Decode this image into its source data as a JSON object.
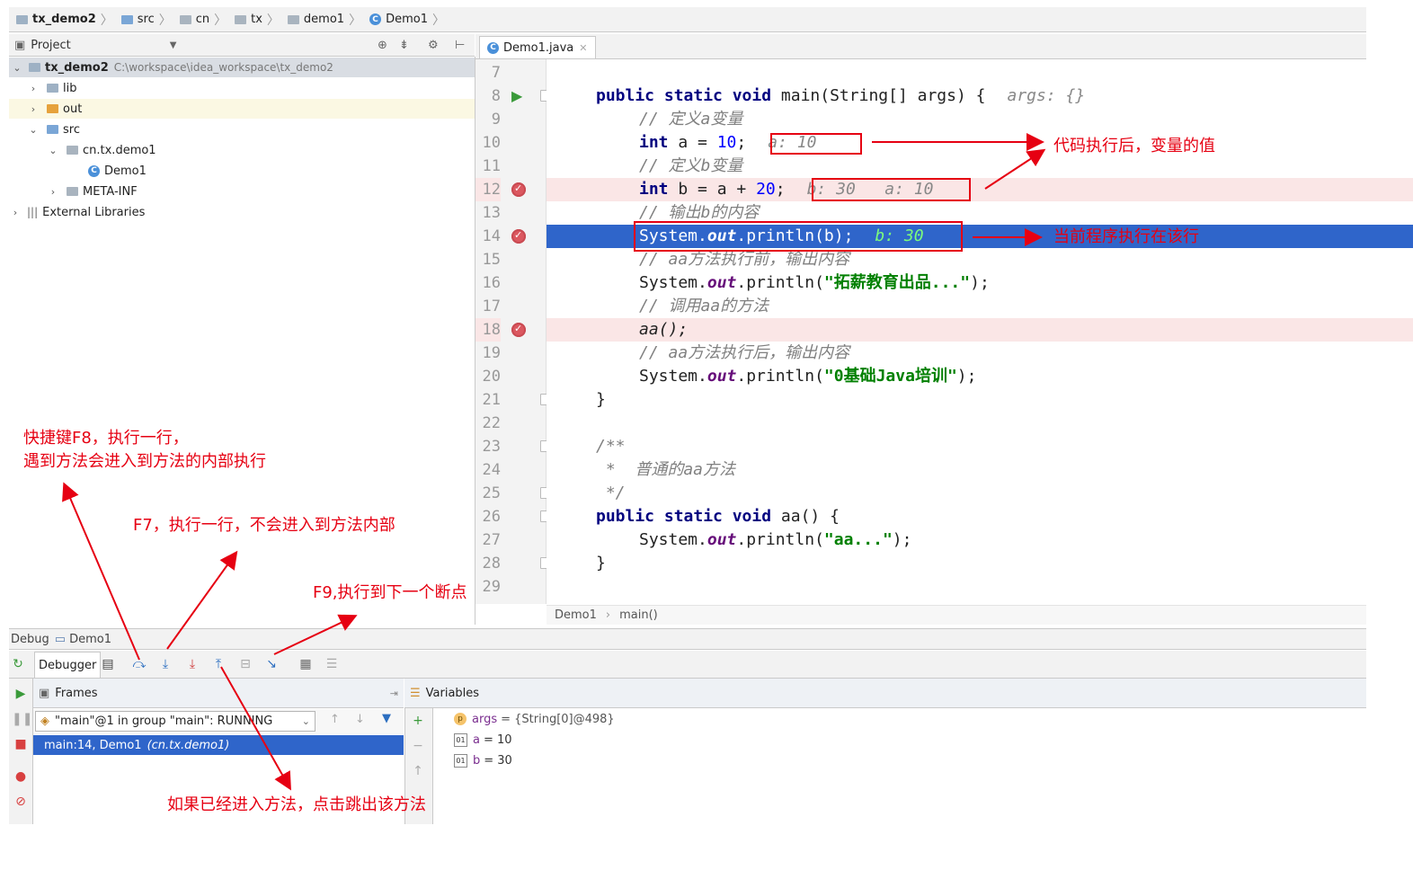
{
  "breadcrumb": [
    "tx_demo2",
    "src",
    "cn",
    "tx",
    "demo1",
    "Demo1"
  ],
  "project": {
    "header": "Project",
    "root_name": "tx_demo2",
    "root_path": "C:\\workspace\\idea_workspace\\tx_demo2",
    "items": [
      "lib",
      "out",
      "src",
      "cn.tx.demo1",
      "Demo1",
      "META-INF",
      "External Libraries"
    ]
  },
  "editor": {
    "tab": "Demo1.java",
    "breadcrumb": [
      "Demo1",
      "main()"
    ],
    "line_numbers": [
      "7",
      "8",
      "9",
      "10",
      "11",
      "12",
      "13",
      "14",
      "15",
      "16",
      "17",
      "18",
      "19",
      "20",
      "21",
      "22",
      "23",
      "24",
      "25",
      "26",
      "27",
      "28",
      "29"
    ],
    "code": {
      "l8_kw": "public static void",
      "l8_rest": " main(String[] args) {",
      "l8_inline": "args: {}",
      "l9": "// 定义a变量",
      "l10_kw": "int",
      "l10_a": " a = ",
      "l10_num": "10",
      "l10_end": ";",
      "l10_inline": "a: 10",
      "l11": "// 定义b变量",
      "l12_kw": "int",
      "l12_a": " b = a + ",
      "l12_num": "20",
      "l12_end": ";",
      "l12_inline": "b: 30   a: 10",
      "l13": "// 输出b的内容",
      "l14_a": "System.",
      "l14_fld": "out",
      "l14_b": ".println(b);",
      "l14_inline": "b: 30",
      "l15": "// aa方法执行前，输出内容",
      "l16_a": "System.",
      "l16_fld": "out",
      "l16_b": ".println(",
      "l16_str": "\"拓薪教育出品...\"",
      "l16_c": ");",
      "l17": "// 调用aa的方法",
      "l18": "aa();",
      "l19": "// aa方法执行后，输出内容",
      "l20_a": "System.",
      "l20_fld": "out",
      "l20_b": ".println(",
      "l20_str": "\"0基础Java培训\"",
      "l20_c": ");",
      "l21": "}",
      "l23": "/**",
      "l24": " *  普通的aa方法",
      "l25": " */",
      "l26_kw": "public static void",
      "l26_rest": " aa() {",
      "l27_a": "System.",
      "l27_fld": "out",
      "l27_b": ".println(",
      "l27_str": "\"aa...\"",
      "l27_c": ");",
      "l28": "}"
    }
  },
  "debug": {
    "title": "Debug",
    "config": "Demo1",
    "debugger_tab": "Debugger",
    "frames_label": "Frames",
    "variables_label": "Variables",
    "thread": "\"main\"@1 in group \"main\": RUNNING",
    "frame": "main:14, Demo1",
    "frame_pkg": "(cn.tx.demo1)",
    "variables": [
      {
        "name": "args",
        "value": "= {String[0]@498}"
      },
      {
        "name": "a",
        "value": "= 10"
      },
      {
        "name": "b",
        "value": "= 30"
      }
    ]
  },
  "annotations": {
    "value_note": "代码执行后，变量的值",
    "current_line_note": "当前程序执行在该行",
    "f8_line1": "快捷键F8，执行一行，",
    "f8_line2": "遇到方法会进入到方法的内部执行",
    "f7": "F7，执行一行，不会进入到方法内部",
    "f9": "F9,执行到下一个断点",
    "step_out": "如果已经进入方法，点击跳出该方法"
  },
  "colors": {
    "accent": "#e60012",
    "selection": "#2f65ca",
    "breakpoint_line": "#fae6e6"
  }
}
